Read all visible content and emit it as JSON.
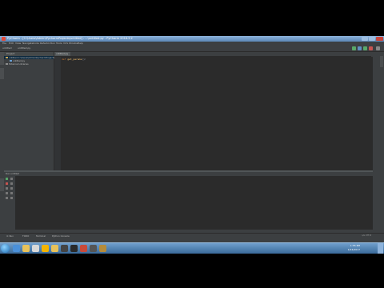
{
  "window": {
    "title": "PyCharm - [C:\\Users\\Admin\\PycharmProjects\\untitled] - ...\\untitled.py - PyCharm 2016.3.2"
  },
  "menubar": {
    "items": [
      "File",
      "Edit",
      "View",
      "Navigate",
      "Code",
      "Refactor",
      "Run",
      "Tools",
      "VCS",
      "Window",
      "Help"
    ]
  },
  "navbar": {
    "project": "untitled",
    "file": "untitled.py"
  },
  "project_panel": {
    "label": "Project",
    "tree": [
      {
        "label": "untitled  C:\\Users\\Admin\\PycharmProjects\\untitled"
      },
      {
        "label": "untitled.py"
      },
      {
        "label": "External Libraries"
      }
    ]
  },
  "editor": {
    "tab": "untitled.py",
    "code_keyword": "def",
    "code_name": "get_params",
    "code_rest": "():"
  },
  "run_panel": {
    "label": "Run  untitled"
  },
  "bottom_tabs": [
    "4: Run",
    "TODO",
    "Terminal",
    "Python Console"
  ],
  "status": {
    "right": "n/a  UTF-8"
  },
  "tray": {
    "time": "1:55 PM",
    "date": "1/24/2017"
  },
  "icons": {
    "run": "run-icon",
    "debug": "debug-icon",
    "start": "windows-start-icon"
  },
  "colors": {
    "run_green": "#59a869",
    "editor_bg": "#2b2b2b",
    "panel_bg": "#3c3f41"
  }
}
